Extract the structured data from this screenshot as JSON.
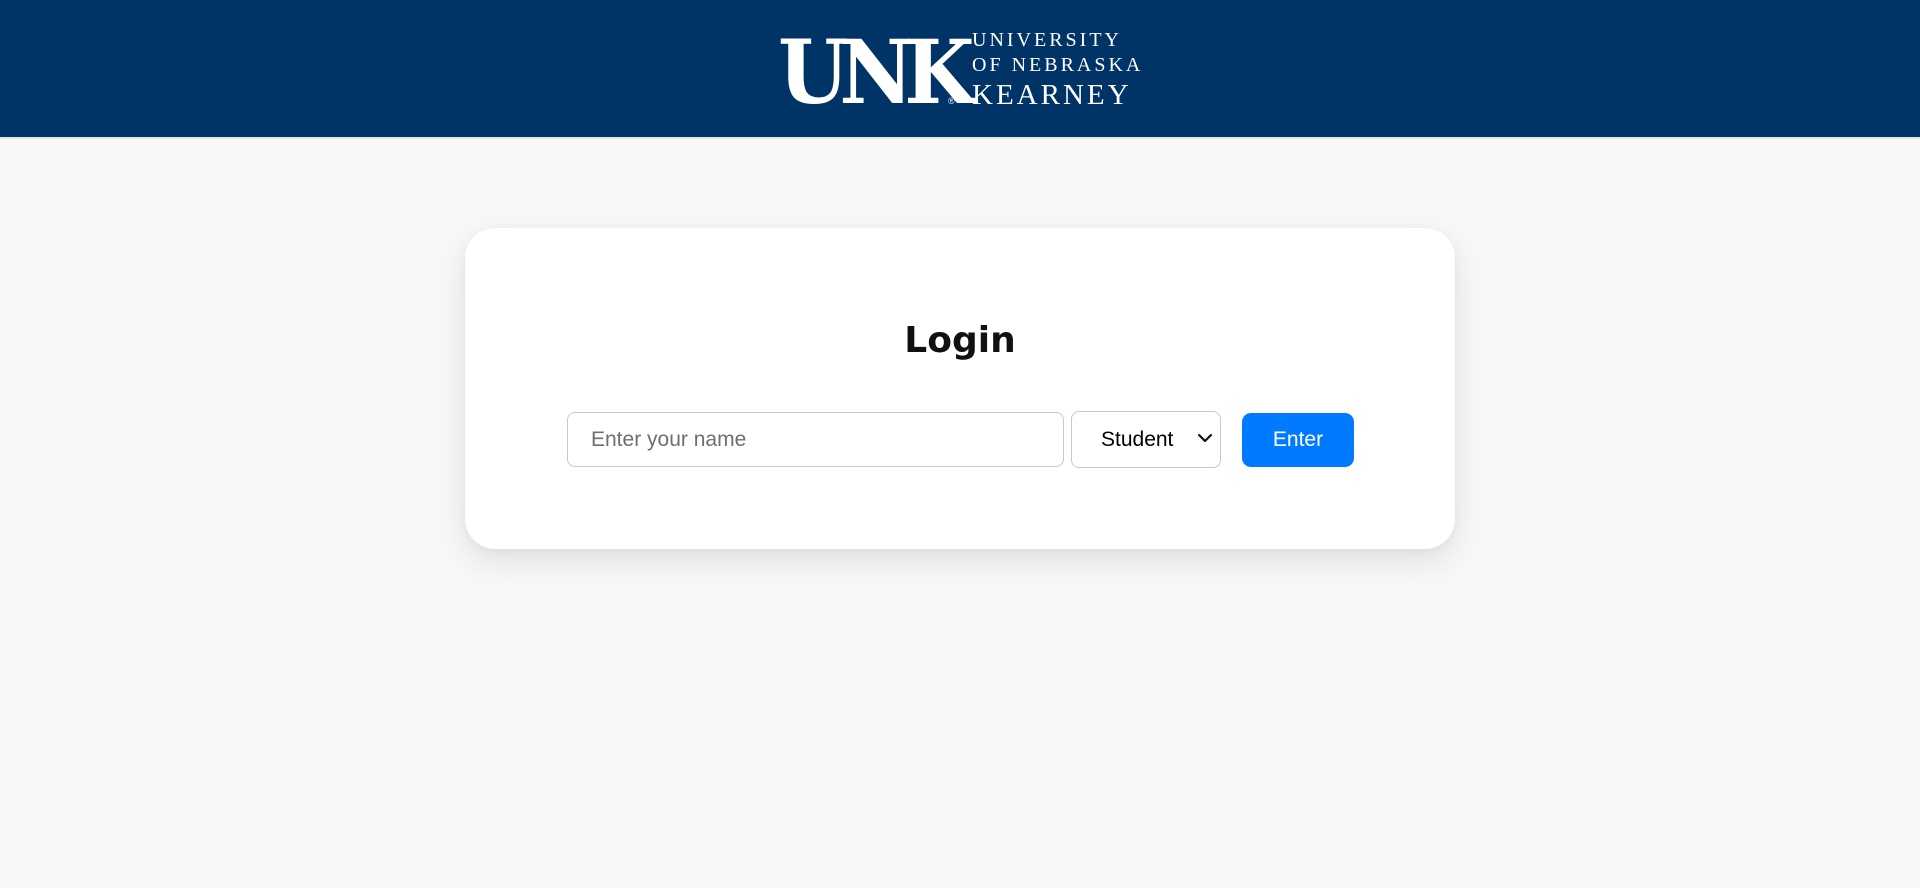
{
  "header": {
    "logo": {
      "mark": "UNK",
      "registered": "®",
      "line1": "UNIVERSITY",
      "line2": "OF NEBRASKA",
      "line3": "KEARNEY"
    },
    "background_color": "#003366"
  },
  "login": {
    "title": "Login",
    "name_placeholder": "Enter your name",
    "name_value": "",
    "role_selected": "Student",
    "enter_label": "Enter",
    "button_color": "#007bff"
  },
  "icons": {
    "role_dropdown": "chevron-down-icon"
  }
}
